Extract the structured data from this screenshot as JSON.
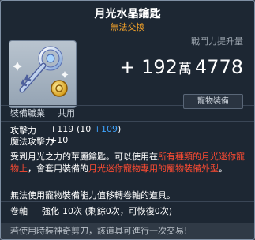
{
  "item": {
    "name": "月光水晶鑰匙",
    "trade_status": "無法交換"
  },
  "power": {
    "label": "戰鬥力提升量",
    "prefix": "+",
    "value_a": "192",
    "unit": "萬",
    "value_b": "4778"
  },
  "tag": "寵物裝備",
  "job": {
    "label": "裝備職業",
    "value": "共用"
  },
  "stats": [
    {
      "label": "攻擊力",
      "total": "+119",
      "base": "(10",
      "bonus": "+109",
      "close": ")"
    },
    {
      "label": "魔法攻擊力",
      "total": "+10",
      "base": "",
      "bonus": "",
      "close": ""
    }
  ],
  "description": {
    "p1_a": "受到月光之力的華麗鑰匙。可以使用在",
    "p1_red1": "所有種類的月光迷你寵物上",
    "p1_b": "，會套用裝備的",
    "p1_red2": "月光迷你寵物專用的寵物裝備外型",
    "p1_c": "。",
    "note": "無法使用寵物裝備能力值移轉卷軸的道具。"
  },
  "scroll": {
    "label": "卷軸",
    "sub": "強化",
    "value": "10次 (剩餘0次，可恢復0次)"
  },
  "footer": "若使用時裝神奇剪刀，該道具可進行一次交易!",
  "colors": {
    "accent_orange": "#f2a12a",
    "red_text": "#ff4b32",
    "blue_text": "#3fa5ff"
  },
  "icon": "crystal-key-icon"
}
